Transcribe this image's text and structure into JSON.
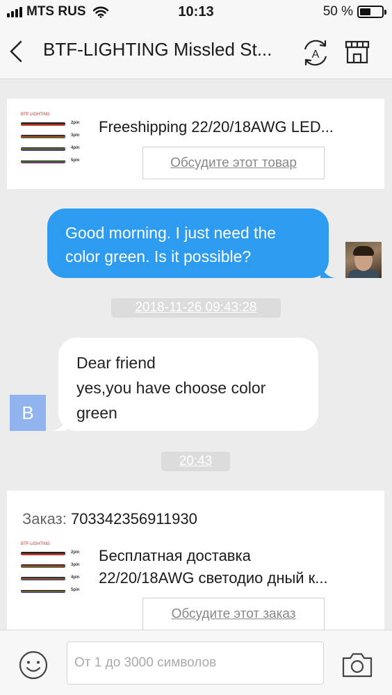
{
  "status_bar": {
    "carrier": "MTS RUS",
    "time": "10:13",
    "battery_percent": "50 %",
    "battery_level": 0.5,
    "signal_icon": "signal-bars-icon",
    "wifi_icon": "wifi-icon",
    "battery_icon": "battery-icon"
  },
  "header": {
    "title": "BTF-LIGHTING Missled St...",
    "back_icon": "chevron-left-icon",
    "translate_icon": "translate-icon",
    "store_icon": "store-icon"
  },
  "product_card": {
    "title": "Freeshipping  22/20/18AWG LED...",
    "discuss_label": "Обсудите этот товар",
    "thumb": {
      "brand": "BTF-LIGHTING",
      "pins": [
        "2pin",
        "3pin",
        "4pin",
        "5pin"
      ]
    }
  },
  "messages": [
    {
      "direction": "outgoing",
      "text": "Good morning. I just need the color green. Is it possible?"
    },
    {
      "direction": "incoming",
      "lines": [
        "Dear friend",
        "yes,you have choose color",
        "green"
      ]
    }
  ],
  "timestamps": [
    "2018-11-26 09:43:28",
    "20:43"
  ],
  "seller_avatar_letter": "B",
  "order_card": {
    "label": "Заказ:",
    "number": "703342356911930",
    "title_line1": "Бесплатная доставка",
    "title_line2": "22/20/18AWG светодио дный к...",
    "discuss_label": "Обсудите этот заказ"
  },
  "input_bar": {
    "placeholder": "От 1 до 3000 символов",
    "emoji_icon": "emoji-icon",
    "camera_icon": "camera-icon"
  },
  "colors": {
    "outgoing_bubble": "#2d9bf0",
    "seller_avatar": "#8fb4ee",
    "background": "#ececec"
  }
}
